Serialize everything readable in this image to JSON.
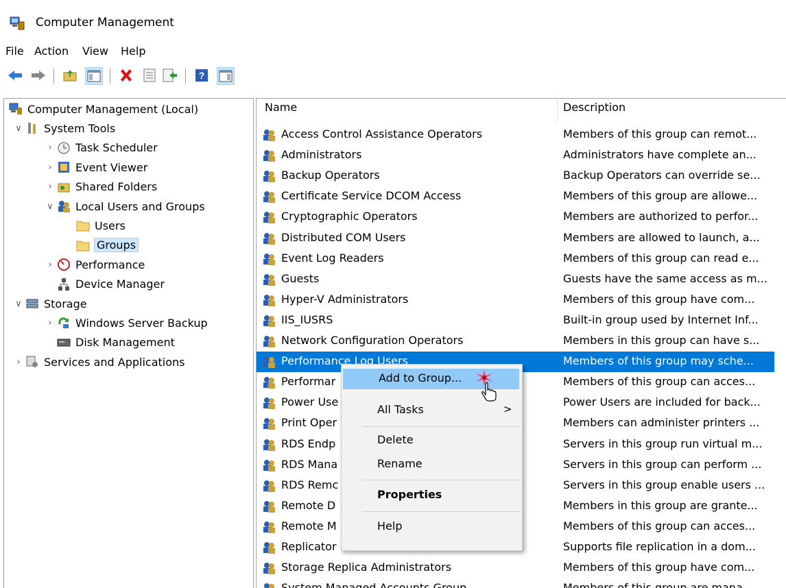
{
  "window": {
    "title": "Computer Management"
  },
  "menu": [
    "File",
    "Action",
    "View",
    "Help"
  ],
  "toolbar_icons": [
    "back-arrow-icon",
    "forward-arrow-icon",
    "up-folder-icon",
    "show-hide-tree-icon",
    "delete-icon",
    "properties-icon",
    "export-list-icon",
    "help-icon",
    "show-hide-action-pane-icon"
  ],
  "tree": [
    {
      "label": "Computer Management (Local)",
      "level": 0,
      "expander": "",
      "icon": "computer-management-icon"
    },
    {
      "label": "System Tools",
      "level": 1,
      "expander": "v",
      "icon": "system-tools-icon"
    },
    {
      "label": "Task Scheduler",
      "level": 2,
      "expander": ">",
      "icon": "task-scheduler-icon"
    },
    {
      "label": "Event Viewer",
      "level": 2,
      "expander": ">",
      "icon": "event-viewer-icon"
    },
    {
      "label": "Shared Folders",
      "level": 2,
      "expander": ">",
      "icon": "shared-folders-icon"
    },
    {
      "label": "Local Users and Groups",
      "level": 2,
      "expander": "v",
      "icon": "local-users-groups-icon"
    },
    {
      "label": "Users",
      "level": 3,
      "expander": "",
      "icon": "folder-icon"
    },
    {
      "label": "Groups",
      "level": 3,
      "expander": "",
      "icon": "folder-icon",
      "selected": true
    },
    {
      "label": "Performance",
      "level": 2,
      "expander": ">",
      "icon": "performance-icon"
    },
    {
      "label": "Device Manager",
      "level": 2,
      "expander": "",
      "icon": "device-manager-icon"
    },
    {
      "label": "Storage",
      "level": 1,
      "expander": "v",
      "icon": "storage-icon"
    },
    {
      "label": "Windows Server Backup",
      "level": 2,
      "expander": ">",
      "icon": "windows-server-backup-icon"
    },
    {
      "label": "Disk Management",
      "level": 2,
      "expander": "",
      "icon": "disk-management-icon"
    },
    {
      "label": "Services and Applications",
      "level": 1,
      "expander": ">",
      "icon": "services-applications-icon"
    }
  ],
  "list": {
    "columns": {
      "name": "Name",
      "description": "Description"
    },
    "rows": [
      {
        "name": "Access Control Assistance Operators",
        "desc": "Members of this group can remot..."
      },
      {
        "name": "Administrators",
        "desc": "Administrators have complete an..."
      },
      {
        "name": "Backup Operators",
        "desc": "Backup Operators can override se..."
      },
      {
        "name": "Certificate Service DCOM Access",
        "desc": "Members of this group are allowe..."
      },
      {
        "name": "Cryptographic Operators",
        "desc": "Members are authorized to perfor..."
      },
      {
        "name": "Distributed COM Users",
        "desc": "Members are allowed to launch, a..."
      },
      {
        "name": "Event Log Readers",
        "desc": "Members of this group can read e..."
      },
      {
        "name": "Guests",
        "desc": "Guests have the same access as m..."
      },
      {
        "name": "Hyper-V Administrators",
        "desc": "Members of this group have com..."
      },
      {
        "name": "IIS_IUSRS",
        "desc": "Built-in group used by Internet Inf..."
      },
      {
        "name": "Network Configuration Operators",
        "desc": "Members in this group can have s..."
      },
      {
        "name": "Performance Log Users",
        "desc": "Members of this group may sche...",
        "selected": true
      },
      {
        "name": "Performar",
        "desc": "Members of this group can acces..."
      },
      {
        "name": "Power Use",
        "desc": "Power Users are included for back..."
      },
      {
        "name": "Print Oper",
        "desc": "Members can administer printers ..."
      },
      {
        "name": "RDS Endp",
        "desc": "Servers in this group run virtual m..."
      },
      {
        "name": "RDS Mana",
        "desc": "Servers in this group can perform ..."
      },
      {
        "name": "RDS Remc",
        "desc": "Servers in this group enable users ..."
      },
      {
        "name": "Remote D",
        "desc": "Members in this group are grante..."
      },
      {
        "name": "Remote M",
        "desc": "Members of this group can acces..."
      },
      {
        "name": "Replicator",
        "desc": "Supports file replication in a dom..."
      },
      {
        "name": "Storage Replica Administrators",
        "desc": "Members of this group have com..."
      },
      {
        "name": "System Managed Accounts Group",
        "desc": "Members of this group are mana..."
      }
    ]
  },
  "context_menu": {
    "items": [
      {
        "label": "Add to Group...",
        "highlighted": true
      },
      {
        "label": "All Tasks",
        "submenu": true
      },
      {
        "label": "Delete"
      },
      {
        "label": "Rename"
      },
      {
        "label": "Properties",
        "bold": true
      },
      {
        "label": "Help"
      }
    ],
    "submenu_arrow": ">"
  },
  "colors": {
    "selection": "#0078d7",
    "menu_highlight": "#91c9f7",
    "tree_selection": "#cce8ff"
  }
}
